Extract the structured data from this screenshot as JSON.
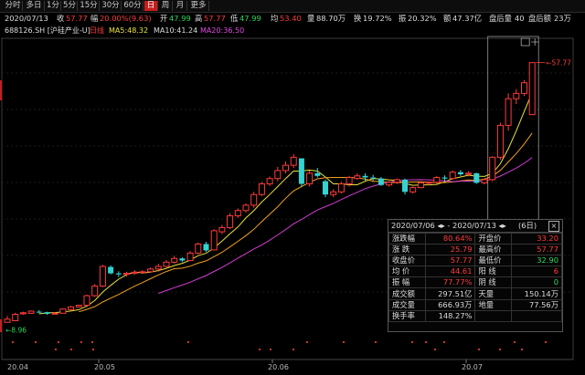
{
  "toolbar": {
    "tabs": [
      {
        "label": "分时",
        "active": false
      },
      {
        "label": "多日",
        "active": false
      },
      {
        "label": "1分",
        "active": false
      },
      {
        "label": "5分",
        "active": false
      },
      {
        "label": "15分",
        "active": false
      },
      {
        "label": "30分",
        "active": false
      },
      {
        "label": "60分",
        "active": false
      },
      {
        "label": "日",
        "active": true
      },
      {
        "label": "周",
        "active": false
      },
      {
        "label": "月",
        "active": false
      },
      {
        "label": "更多",
        "active": false
      }
    ]
  },
  "info": {
    "date": "2020/07/13",
    "close_label": "收",
    "close": "57.77",
    "change_label": "幅",
    "change": "20.00%(9.63)",
    "open_label": "开",
    "open": "47.99",
    "high_label": "高",
    "high": "57.77",
    "low_label": "低",
    "low": "47.99",
    "avg_label": "均",
    "avg": "53.40",
    "volume_label": "量",
    "volume": "88.70万",
    "turnover_label": "换",
    "turnover": "19.72%",
    "amplitude_label": "振",
    "amplitude": "20.32%",
    "amount_label": "额",
    "amount": "47.37亿",
    "after_vol_label": "盘后量",
    "after_vol": "40",
    "after_amt_label": "盘后额",
    "after_amt": "23万"
  },
  "ma": {
    "symbol": "688126.SH [沪硅产业-U]",
    "period": "日线",
    "ma5": "MA5:48.32",
    "ma10": "MA10:41.24",
    "ma20": "MA20:36.50"
  },
  "chart_data": {
    "type": "candlestick",
    "price_range": [
      7.5,
      62
    ],
    "high_marker": "57.77",
    "low_marker": "8.96",
    "x_ticks": [
      "20.04",
      "20.05",
      "20.06",
      "20.07"
    ],
    "candles": [
      [
        9.0,
        10.2,
        9.6,
        9.0
      ],
      [
        9.3,
        10.8,
        10.5,
        9.3
      ],
      [
        10.6,
        11.0,
        10.8,
        10.4
      ],
      [
        10.7,
        11.2,
        11.1,
        10.6
      ],
      [
        11.0,
        11.3,
        10.9,
        10.7
      ],
      [
        10.9,
        11.0,
        10.6,
        10.4
      ],
      [
        10.6,
        10.9,
        10.7,
        10.5
      ],
      [
        10.7,
        11.6,
        11.5,
        10.7
      ],
      [
        11.4,
        12.1,
        11.9,
        11.2
      ],
      [
        11.9,
        12.3,
        12.2,
        11.8
      ],
      [
        12.2,
        14.2,
        14.0,
        12.2
      ],
      [
        14.0,
        16.2,
        15.8,
        13.8
      ],
      [
        15.8,
        19.8,
        19.5,
        15.6
      ],
      [
        19.4,
        19.7,
        18.2,
        18.0
      ],
      [
        18.2,
        18.6,
        18.0,
        17.5
      ],
      [
        18.0,
        18.5,
        18.2,
        17.6
      ],
      [
        18.2,
        18.8,
        18.4,
        17.9
      ],
      [
        18.4,
        18.8,
        18.5,
        18.1
      ],
      [
        18.5,
        19.3,
        19.0,
        18.3
      ],
      [
        19.0,
        20.0,
        19.5,
        18.5
      ],
      [
        19.5,
        20.7,
        20.3,
        19.3
      ],
      [
        20.3,
        21.5,
        21.0,
        20.0
      ],
      [
        21.0,
        21.2,
        20.6,
        20.3
      ],
      [
        20.6,
        22.4,
        22.0,
        20.5
      ],
      [
        22.0,
        24.0,
        23.7,
        21.8
      ],
      [
        23.7,
        24.1,
        22.5,
        22.2
      ],
      [
        22.6,
        26.5,
        26.2,
        22.5
      ],
      [
        26.0,
        27.3,
        26.8,
        25.6
      ],
      [
        26.8,
        29.5,
        29.0,
        26.5
      ],
      [
        29.0,
        30.4,
        30.0,
        28.6
      ],
      [
        30.0,
        31.3,
        31.0,
        29.6
      ],
      [
        31.0,
        33.5,
        33.0,
        30.5
      ],
      [
        33.0,
        35.4,
        35.0,
        32.7
      ],
      [
        35.0,
        36.4,
        36.0,
        34.6
      ],
      [
        36.0,
        38.2,
        37.5,
        35.5
      ],
      [
        37.5,
        39.2,
        38.5,
        37.0
      ],
      [
        38.5,
        40.6,
        40.0,
        38.0
      ],
      [
        39.8,
        38.2,
        35.0,
        34.5
      ],
      [
        35.0,
        37.5,
        37.0,
        34.5
      ],
      [
        37.0,
        38.0,
        36.5,
        36.2
      ],
      [
        35.5,
        35.8,
        33.0,
        32.5
      ],
      [
        33.0,
        34.0,
        33.5,
        32.5
      ],
      [
        33.5,
        35.4,
        35.0,
        33.2
      ],
      [
        35.0,
        36.5,
        36.2,
        34.5
      ],
      [
        36.0,
        37.0,
        36.5,
        35.8
      ],
      [
        36.5,
        37.0,
        36.2,
        35.6
      ],
      [
        36.2,
        36.7,
        36.0,
        35.6
      ],
      [
        36.0,
        36.3,
        34.8,
        34.6
      ],
      [
        34.8,
        35.5,
        35.3,
        34.5
      ],
      [
        35.3,
        36.0,
        35.8,
        35.0
      ],
      [
        35.8,
        36.0,
        33.5,
        33.0
      ],
      [
        33.5,
        34.5,
        34.3,
        33.2
      ],
      [
        34.3,
        35.5,
        35.2,
        34.2
      ],
      [
        35.2,
        35.5,
        35.3,
        34.7
      ],
      [
        35.3,
        36.5,
        36.2,
        35.0
      ],
      [
        36.2,
        36.6,
        36.0,
        35.5
      ],
      [
        36.0,
        37.5,
        37.2,
        35.8
      ],
      [
        37.2,
        37.6,
        36.8,
        36.5
      ],
      [
        36.8,
        37.4,
        37.0,
        36.4
      ],
      [
        37.0,
        37.1,
        35.2,
        35.0
      ],
      [
        35.2,
        36.0,
        35.8,
        34.9
      ],
      [
        35.8,
        40.2,
        40.0,
        35.5
      ],
      [
        40.0,
        46.5,
        46.0,
        39.5
      ],
      [
        46.0,
        52.0,
        51.0,
        45.0
      ],
      [
        51.0,
        52.8,
        52.0,
        50.0
      ],
      [
        52.0,
        54.5,
        54.0,
        51.5
      ],
      [
        48.0,
        57.77,
        57.77,
        47.99
      ]
    ],
    "ma_series": [
      {
        "name": "MA5",
        "color": "#e7e13a"
      },
      {
        "name": "MA10",
        "color": "#f0a020"
      },
      {
        "name": "MA20",
        "color": "#d23cd2"
      }
    ]
  },
  "panel": {
    "range": "2020/07/06 ◂▸ - 2020/07/13 ◂▸",
    "days": "(6日)",
    "close_icon": "close-icon",
    "rows": [
      [
        "涨跌幅",
        "80.64%",
        "开盘价",
        "33.20"
      ],
      [
        "涨  跌",
        "25.79",
        "最高价",
        "57.77"
      ],
      [
        "收盘价",
        "57.77",
        "最低价",
        "32.90"
      ],
      [
        "均  价",
        "44.61",
        "阳  线",
        "6"
      ],
      [
        "振  幅",
        "77.77%",
        "阴  线",
        "0"
      ],
      [
        "成交额",
        "297.51亿",
        "天量",
        "150.14万"
      ],
      [
        "成交量",
        "666.93万",
        "地量",
        "77.56万"
      ],
      [
        "换手率",
        "148.27%",
        "",
        ""
      ]
    ]
  },
  "colors": {
    "up": "#ff3b3b",
    "down": "#35d2d2",
    "accent": "#c71d1d"
  }
}
